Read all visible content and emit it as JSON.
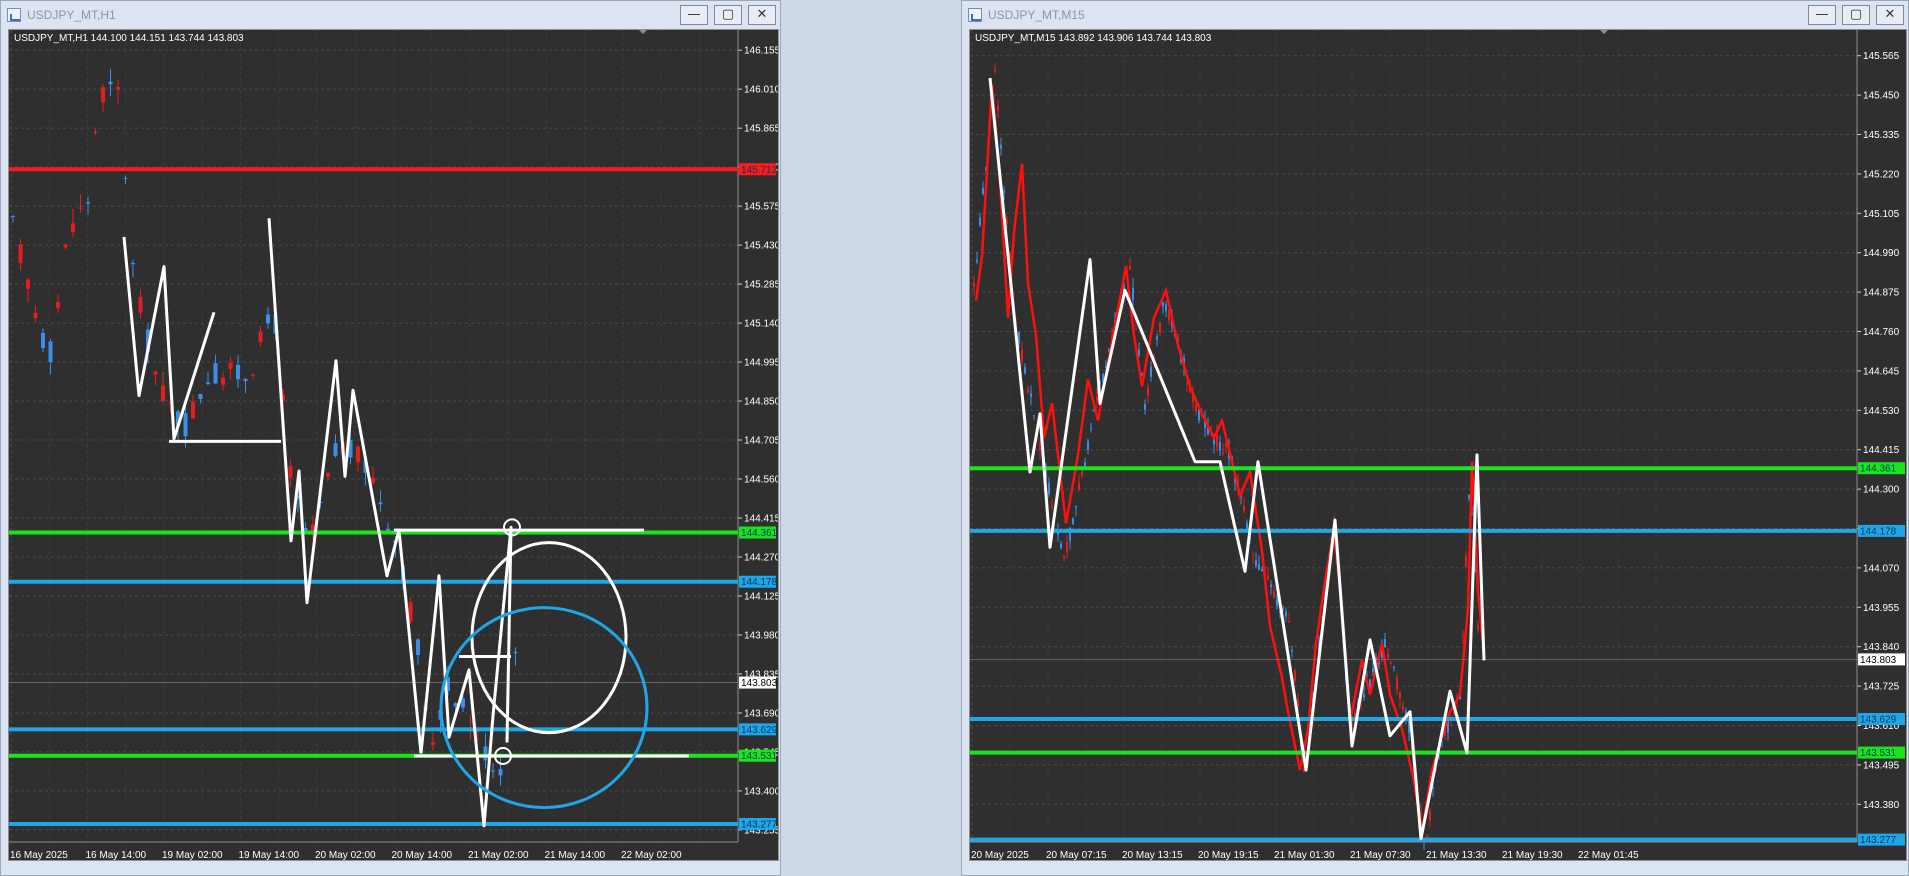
{
  "windows": [
    {
      "id": "h1",
      "title": "USDJPY_MT,H1",
      "info_line": "USDJPY_MT,H1  144.100 144.151 143.744 143.803",
      "y_range": [
        143.21,
        146.23
      ],
      "price_ticks": [
        "146.155",
        "146.010",
        "145.865",
        "145.720",
        "145.575",
        "145.430",
        "145.285",
        "145.140",
        "144.995",
        "144.850",
        "144.705",
        "144.560",
        "144.415",
        "144.270",
        "144.125",
        "143.980",
        "143.835",
        "143.690",
        "143.545",
        "143.400",
        "143.255"
      ],
      "time_labels": [
        "16 May 2025",
        "16 May 14:00",
        "19 May 02:00",
        "19 May 14:00",
        "20 May 02:00",
        "20 May 14:00",
        "21 May 02:00",
        "21 May 14:00",
        "22 May 02:00"
      ],
      "current_price": "143.803",
      "levels": [
        {
          "price": 145.712,
          "label": "145.712",
          "color": "#ff1a1a"
        },
        {
          "price": 144.361,
          "label": "144.361",
          "color": "#19e619"
        },
        {
          "price": 144.178,
          "label": "144.178",
          "color": "#1fa6e6"
        },
        {
          "price": 143.629,
          "label": "143.629",
          "color": "#1fa6e6"
        },
        {
          "price": 143.531,
          "label": "143.531",
          "color": "#19e619"
        },
        {
          "price": 143.277,
          "label": "143.277",
          "color": "#1fa6e6"
        }
      ]
    },
    {
      "id": "m15",
      "title": "USDJPY_MT,M15",
      "info_line": "USDJPY_MT,M15  143.892 143.906 143.744 143.803",
      "y_range": [
        143.27,
        145.64
      ],
      "price_ticks": [
        "145.565",
        "145.450",
        "145.335",
        "145.220",
        "145.105",
        "144.990",
        "144.875",
        "144.760",
        "144.645",
        "144.530",
        "144.415",
        "144.300",
        "144.185",
        "144.070",
        "143.955",
        "143.840",
        "143.725",
        "143.610",
        "143.495",
        "143.380"
      ],
      "time_labels": [
        "20 May 2025",
        "20 May 07:15",
        "20 May 13:15",
        "20 May 19:15",
        "21 May 01:30",
        "21 May 07:30",
        "21 May 13:30",
        "21 May 19:30",
        "22 May 01:45"
      ],
      "current_price": "143.803",
      "levels": [
        {
          "price": 144.361,
          "label": "144.361",
          "color": "#19e619"
        },
        {
          "price": 144.178,
          "label": "144.178",
          "color": "#1fa6e6"
        },
        {
          "price": 143.629,
          "label": "143.629",
          "color": "#1fa6e6"
        },
        {
          "price": 143.531,
          "label": "143.531",
          "color": "#19e619"
        },
        {
          "price": 143.277,
          "label": "143.277",
          "color": "#1fa6e6"
        }
      ]
    }
  ],
  "window_buttons": {
    "minimize": "—",
    "maximize": "▢",
    "close": "✕"
  },
  "colors": {
    "bull": "#3b8fe8",
    "bear": "#e61e1e",
    "grid": "#4a4a4a",
    "background": "#2f2f2f",
    "drawing": "#ffffff"
  }
}
